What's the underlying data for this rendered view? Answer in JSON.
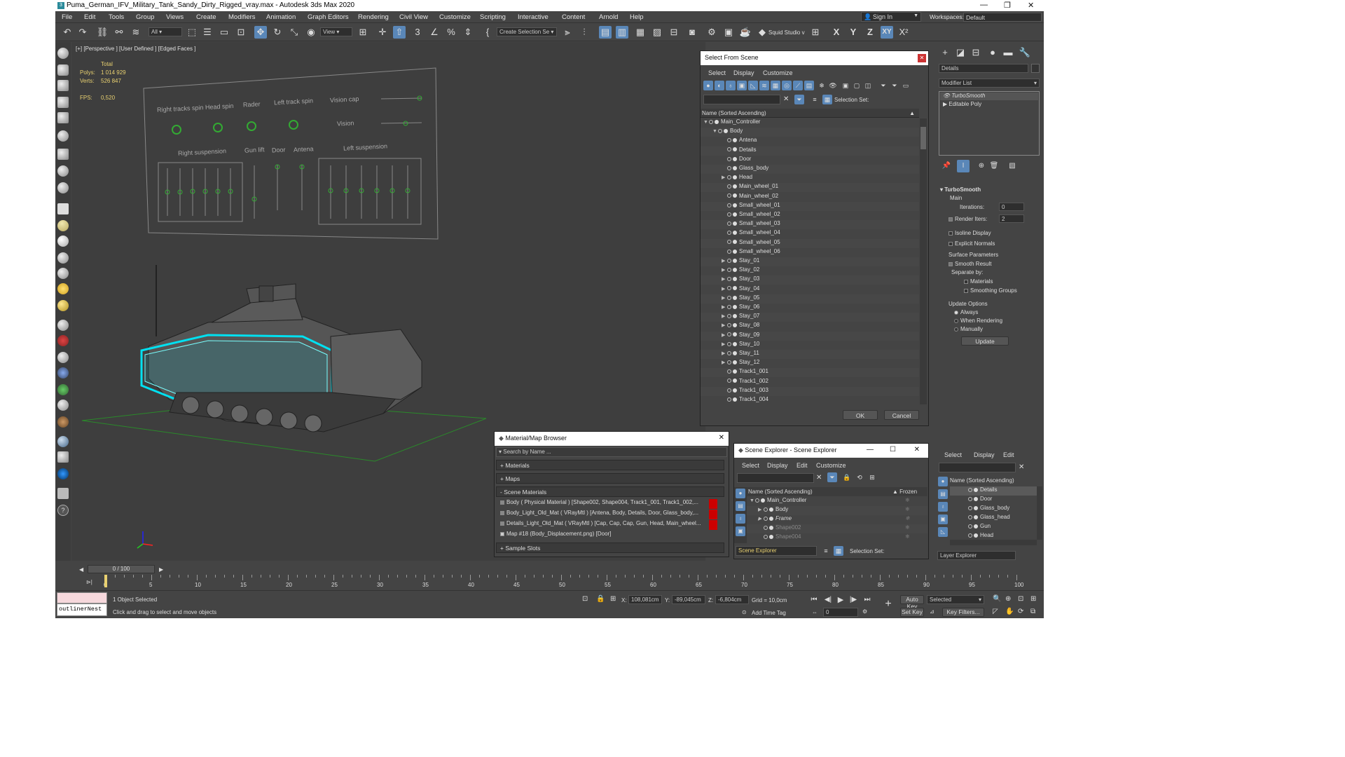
{
  "window": {
    "title": "Puma_German_IFV_Military_Tank_Sandy_Dirty_Rigged_vray.max - Autodesk 3ds Max 2020"
  },
  "menu": [
    "File",
    "Edit",
    "Tools",
    "Group",
    "Views",
    "Create",
    "Modifiers",
    "Animation",
    "Graph Editors",
    "Rendering",
    "Civil View",
    "Customize",
    "Scripting",
    "Interactive",
    "Content",
    "Arnold",
    "Help"
  ],
  "signin": "Sign In",
  "workspaces_label": "Workspaces:",
  "workspaces_value": "Default",
  "toolbar": {
    "filter": "All",
    "ref_coord": "View",
    "selection_set": "Create Selection Se",
    "squid": "Squid Studio v",
    "axes": [
      "X",
      "Y",
      "Z",
      "XY"
    ]
  },
  "viewport": {
    "label": "[+] [Perspective ] [User Defined ] [Edged Faces ]",
    "stats": {
      "total": "Total",
      "polys_label": "Polys:",
      "polys": "1 014 929",
      "verts_label": "Verts:",
      "verts": "526 847",
      "fps_label": "FPS:",
      "fps": "0,520"
    },
    "rig_labels": [
      "Right tracks spin",
      "Head spin",
      "Rader",
      "Left track spin",
      "Vision cap",
      "Vision",
      "Right suspension",
      "Gun lift",
      "Door",
      "Antena",
      "Left suspension"
    ]
  },
  "select_from_scene": {
    "title": "Select From Scene",
    "menu": [
      "Select",
      "Display",
      "Customize"
    ],
    "selection_set": "Selection Set:",
    "header": "Name (Sorted Ascending)",
    "rows": [
      {
        "name": "Main_Controller",
        "level": 0,
        "expand": "▼"
      },
      {
        "name": "Body",
        "level": 1,
        "expand": "▼"
      },
      {
        "name": "Antena",
        "level": 2,
        "expand": ""
      },
      {
        "name": "Details",
        "level": 2,
        "expand": ""
      },
      {
        "name": "Door",
        "level": 2,
        "expand": ""
      },
      {
        "name": "Glass_body",
        "level": 2,
        "expand": ""
      },
      {
        "name": "Head",
        "level": 2,
        "expand": "▶"
      },
      {
        "name": "Main_wheel_01",
        "level": 2,
        "expand": ""
      },
      {
        "name": "Main_wheel_02",
        "level": 2,
        "expand": ""
      },
      {
        "name": "Small_wheel_01",
        "level": 2,
        "expand": ""
      },
      {
        "name": "Small_wheel_02",
        "level": 2,
        "expand": ""
      },
      {
        "name": "Small_wheel_03",
        "level": 2,
        "expand": ""
      },
      {
        "name": "Small_wheel_04",
        "level": 2,
        "expand": ""
      },
      {
        "name": "Small_wheel_05",
        "level": 2,
        "expand": ""
      },
      {
        "name": "Small_wheel_06",
        "level": 2,
        "expand": ""
      },
      {
        "name": "Stay_01",
        "level": 2,
        "expand": "▶"
      },
      {
        "name": "Stay_02",
        "level": 2,
        "expand": "▶"
      },
      {
        "name": "Stay_03",
        "level": 2,
        "expand": "▶"
      },
      {
        "name": "Stay_04",
        "level": 2,
        "expand": "▶"
      },
      {
        "name": "Stay_05",
        "level": 2,
        "expand": "▶"
      },
      {
        "name": "Stay_06",
        "level": 2,
        "expand": "▶"
      },
      {
        "name": "Stay_07",
        "level": 2,
        "expand": "▶"
      },
      {
        "name": "Stay_08",
        "level": 2,
        "expand": "▶"
      },
      {
        "name": "Stay_09",
        "level": 2,
        "expand": "▶"
      },
      {
        "name": "Stay_10",
        "level": 2,
        "expand": "▶"
      },
      {
        "name": "Stay_11",
        "level": 2,
        "expand": "▶"
      },
      {
        "name": "Stay_12",
        "level": 2,
        "expand": "▶"
      },
      {
        "name": "Track1_001",
        "level": 2,
        "expand": ""
      },
      {
        "name": "Track1_002",
        "level": 2,
        "expand": ""
      },
      {
        "name": "Track1_003",
        "level": 2,
        "expand": ""
      },
      {
        "name": "Track1_004",
        "level": 2,
        "expand": ""
      }
    ],
    "ok": "OK",
    "cancel": "Cancel"
  },
  "material_browser": {
    "title": "Material/Map Browser",
    "search": "Search by Name ...",
    "sections": [
      "+ Materials",
      "+ Maps",
      "- Scene Materials",
      "+ Sample Slots"
    ],
    "materials": [
      "Body  ( Physical Material )  [Shape002, Shape004, Track1_001, Track1_002,...",
      "Body_Light_Old_Mat  ( VRayMtl )  [Antena, Body, Details, Door, Glass_body,...",
      "Details_Light_Old_Mat  ( VRayMtl )  [Cap, Cap, Cap, Gun, Head, Main_wheel...",
      "Map #18 (Body_Displacement.png)  [Door]"
    ]
  },
  "scene_explorer": {
    "title": "Scene Explorer - Scene Explorer",
    "menu": [
      "Select",
      "Display",
      "Edit",
      "Customize"
    ],
    "header": "Name (Sorted Ascending)",
    "frozen": "▲ Frozen",
    "rows": [
      {
        "name": "Main_Controller",
        "level": 0,
        "expand": "▼"
      },
      {
        "name": "Body",
        "level": 1,
        "expand": "▶"
      },
      {
        "name": "Frame",
        "level": 1,
        "expand": "▶"
      },
      {
        "name": "Shape002",
        "level": 1,
        "expand": ""
      },
      {
        "name": "Shape004",
        "level": 1,
        "expand": ""
      }
    ],
    "footer_name": "Scene Explorer",
    "selection_set": "Selection Set:"
  },
  "layer_explorer": {
    "menu": [
      "Select",
      "Display",
      "Edit"
    ],
    "header": "Name (Sorted Ascending)",
    "rows": [
      "Details",
      "Door",
      "Glass_body",
      "Glass_head",
      "Gun",
      "Head"
    ],
    "footer": "Layer Explorer"
  },
  "command_panel": {
    "object_name": "Details",
    "modifier_list": "Modifier List",
    "stack": [
      "TurboSmooth",
      "Editable Poly"
    ],
    "rollout": "TurboSmooth",
    "main": "Main",
    "iterations_label": "Iterations:",
    "iterations": "0",
    "render_iters_label": "Render Iters:",
    "render_iters": "2",
    "isoline": "Isoline Display",
    "explicit": "Explicit Normals",
    "surface": "Surface Parameters",
    "smooth_result": "Smooth Result",
    "separate_by": "Separate by:",
    "materials": "Materials",
    "smoothing_groups": "Smoothing Groups",
    "update_options": "Update Options",
    "always": "Always",
    "when_rendering": "When Rendering",
    "manually": "Manually",
    "update": "Update"
  },
  "timeline": {
    "frame": "0 / 100",
    "ticks": [
      "0",
      "5",
      "10",
      "15",
      "20",
      "25",
      "30",
      "35",
      "40",
      "45",
      "50",
      "55",
      "60",
      "65",
      "70",
      "75",
      "80",
      "85",
      "90",
      "95",
      "100"
    ]
  },
  "status": {
    "script_listener": "outlinerNest",
    "selected": "1 Object Selected",
    "prompt": "Click and drag to select and move objects",
    "x_label": "X:",
    "x": "108,081cm",
    "y_label": "Y:",
    "y": "-89,045cm",
    "z_label": "Z:",
    "z": "-6,804cm",
    "grid": "Grid = 10,0cm",
    "add_time_tag": "Add Time Tag",
    "auto_key": "Auto Key",
    "selected_dd": "Selected",
    "set_key": "Set Key",
    "key_filters": "Key Filters...",
    "frame": "0"
  }
}
